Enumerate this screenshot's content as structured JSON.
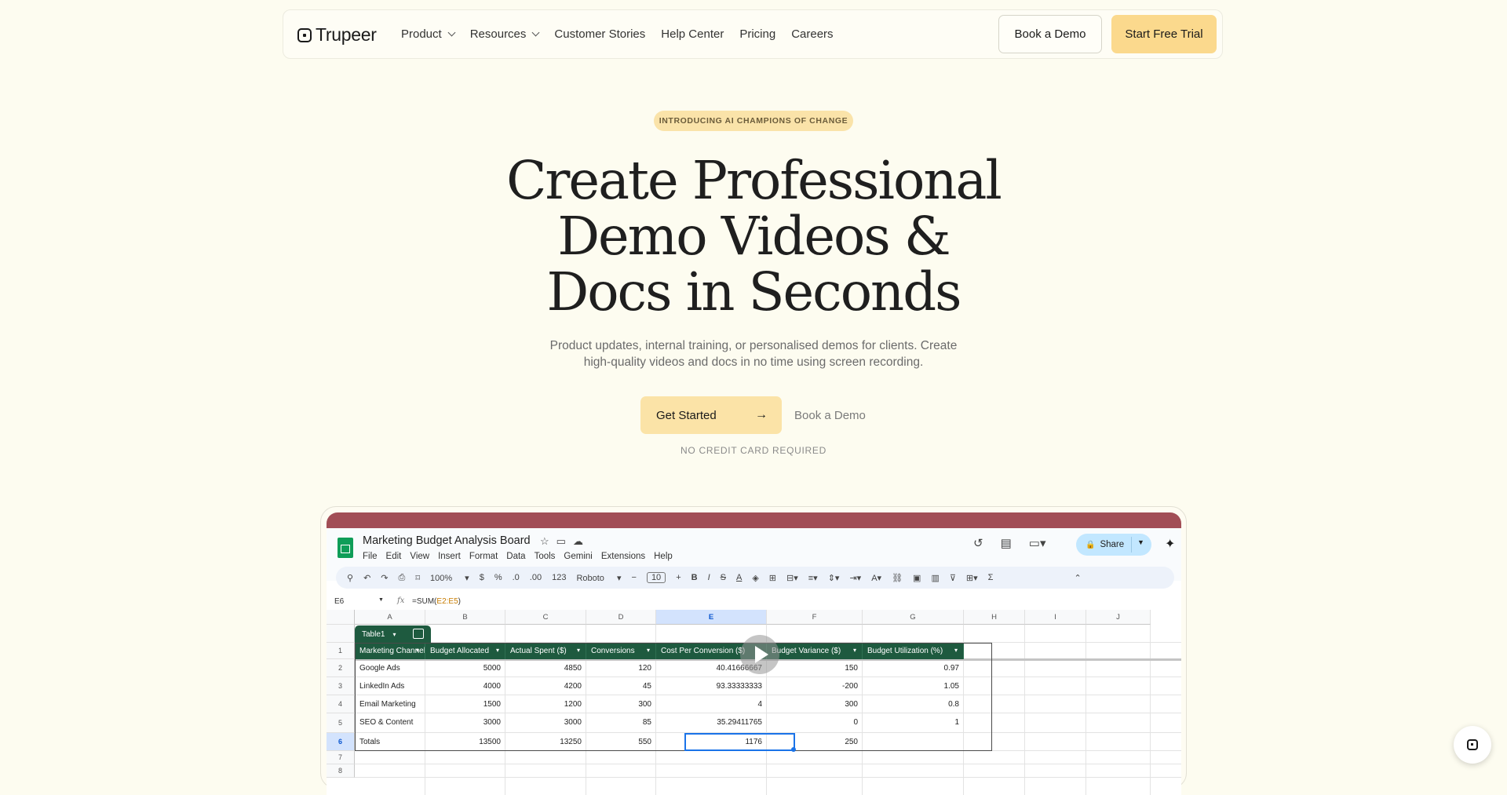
{
  "nav": {
    "logo": "Trupeer",
    "links": [
      {
        "label": "Product",
        "dropdown": true
      },
      {
        "label": "Resources",
        "dropdown": true
      },
      {
        "label": "Customer Stories",
        "dropdown": false
      },
      {
        "label": "Help Center",
        "dropdown": false
      },
      {
        "label": "Pricing",
        "dropdown": false
      },
      {
        "label": "Careers",
        "dropdown": false
      }
    ],
    "book_demo": "Book a Demo",
    "start_trial": "Start Free Trial"
  },
  "hero": {
    "badge": "INTRODUCING AI CHAMPIONS OF CHANGE",
    "title_lines": [
      "Create Professional",
      "Demo Videos &",
      "Docs in Seconds"
    ],
    "subtitle_lines": [
      "Product updates, internal training, or personalised demos for clients. Create",
      "high-quality videos and docs in no time using screen recording."
    ],
    "cta_primary": "Get Started",
    "cta_secondary": "Book a Demo",
    "note": "NO CREDIT CARD REQUIRED"
  },
  "sheet": {
    "title": "Marketing Budget Analysis Board",
    "menu": [
      "File",
      "Edit",
      "View",
      "Insert",
      "Format",
      "Data",
      "Tools",
      "Gemini",
      "Extensions",
      "Help"
    ],
    "share": "Share",
    "toolbar": {
      "zoom": "100%",
      "currency": "$",
      "percent": "%",
      "dec_less": ".0",
      "dec_more": ".00",
      "format_123": "123",
      "font": "Roboto",
      "font_size": "10"
    },
    "cell_ref": "E6",
    "formula_prefix": "=SUM(",
    "formula_range": "E2:E5",
    "formula_suffix": ")",
    "columns": [
      "A",
      "B",
      "C",
      "D",
      "E",
      "F",
      "G",
      "H",
      "I",
      "J"
    ],
    "rows": [
      "1",
      "2",
      "3",
      "4",
      "5",
      "6",
      "7",
      "8"
    ],
    "table_name": "Table1",
    "headers": [
      "Marketing Channel",
      "Budget Allocated",
      "Actual Spent ($)",
      "Conversions",
      "Cost Per Conversion ($)",
      "Budget Variance ($)",
      "Budget Utilization (%)"
    ],
    "data": [
      [
        "Google Ads",
        "5000",
        "4850",
        "120",
        "40.41666667",
        "150",
        "0.97"
      ],
      [
        "LinkedIn Ads",
        "4000",
        "4200",
        "45",
        "93.33333333",
        "-200",
        "1.05"
      ],
      [
        "Email Marketing",
        "1500",
        "1200",
        "300",
        "4",
        "300",
        "0.8"
      ],
      [
        "SEO & Content",
        "3000",
        "3000",
        "85",
        "35.29411765",
        "0",
        "1"
      ],
      [
        "Totals",
        "13500",
        "13250",
        "550",
        "1176",
        "250",
        ""
      ]
    ]
  }
}
